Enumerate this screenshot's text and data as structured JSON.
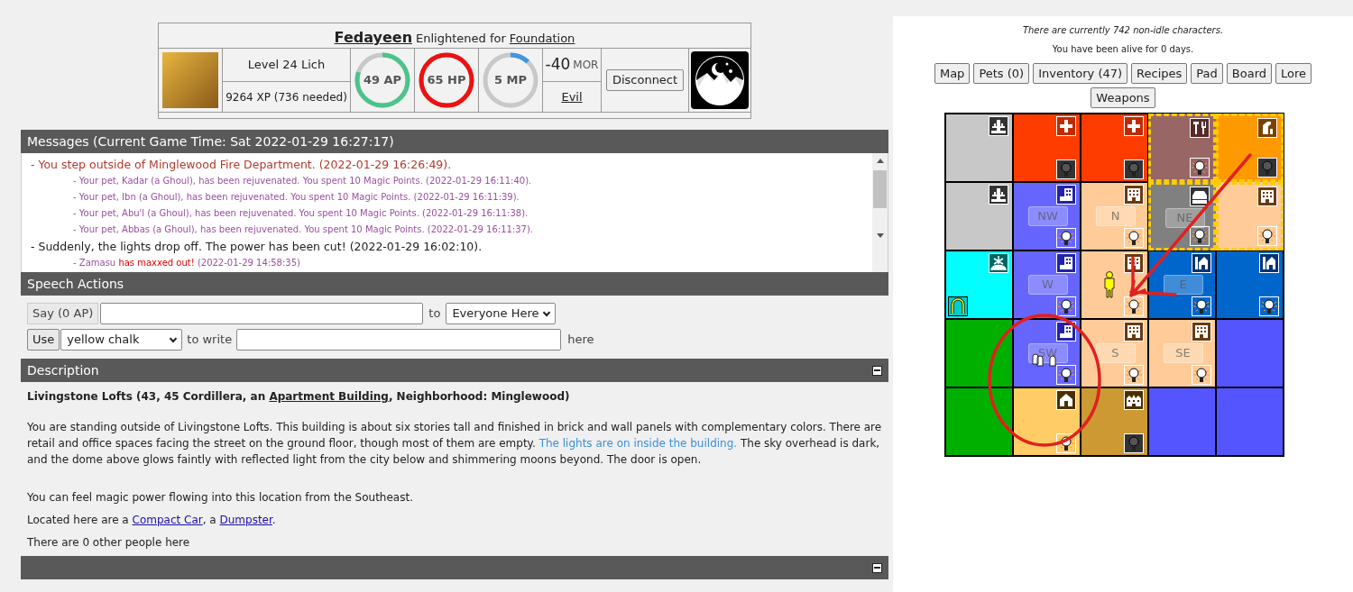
{
  "character": {
    "name": "Fedayeen",
    "title": "Enlightened for",
    "faction": "Foundation",
    "level": "Level 24 Lich",
    "xp": "9264 XP (736 needed)",
    "stats": [
      {
        "label": "49 AP",
        "level": 0.8,
        "color": "#4cc38a"
      },
      {
        "label": "65 HP",
        "level": 1,
        "color": "#ee1111"
      },
      {
        "label": "5 MP",
        "level": 0.12,
        "color": "#3f97e0"
      }
    ],
    "morality": "-40",
    "morality_unit": "MOR",
    "alignment": "Evil",
    "disconnect": "Disconnect"
  },
  "messages": {
    "title": "Messages (Current Game Time: Sat 2022-01-29 16:27:17)",
    "items": [
      {
        "kind": "action",
        "text": "- You step outside of Minglewood Fire Department. (2022-01-29 16:26:49)."
      },
      {
        "kind": "pet",
        "text": "- Your pet, Kadar (a Ghoul), has been rejuvenated. You spent 10 Magic Points. (2022-01-29 16:11:40)."
      },
      {
        "kind": "pet",
        "text": "- Your pet, Ibn (a Ghoul), has been rejuvenated. You spent 10 Magic Points. (2022-01-29 16:11:39)."
      },
      {
        "kind": "pet",
        "text": "- Your pet, Abu'l (a Ghoul), has been rejuvenated. You spent 10 Magic Points. (2022-01-29 16:11:38)."
      },
      {
        "kind": "pet",
        "text": "- Your pet, Abbas (a Ghoul), has been rejuvenated. You spent 10 Magic Points. (2022-01-29 16:11:37)."
      },
      {
        "kind": "event",
        "text": "- Suddenly, the lights drop off. The power has been cut! (2022-01-29 16:02:10)."
      },
      {
        "kind": "pet",
        "text": "- Zamasu ",
        "alert": "has maxxed out!",
        "tail": " (2022-01-29 14:58:35)"
      }
    ]
  },
  "speech_actions": {
    "title": "Speech Actions",
    "say_button": "Say (0 AP)",
    "to": "to",
    "target": "Everyone Here",
    "use_button": "Use",
    "item": "yellow chalk",
    "to_write": "to write",
    "here": "here"
  },
  "description": {
    "title": "Description",
    "heading": [
      {
        "text": "Livingstone Lofts (43, 45 Cordillera, an ",
        "link": false
      },
      {
        "text": "Apartment Building",
        "link": true
      },
      {
        "text": ", Neighborhood: Minglewood)",
        "link": false
      }
    ],
    "paragraph": [
      {
        "text": "You are standing outside of Livingstone Lofts. This building is about six stories tall and finished in brick and wall panels with complementary colors. There are retail and office spaces facing the street on the ground floor, though most of them are empty. ",
        "lit": false
      },
      {
        "text": "The lights are on inside the building.",
        "lit": true
      },
      {
        "text": " The sky overhead is dark, and the dome above glows faintly with reflected light from the city below and shimmering moons beyond. The door is open.",
        "lit": false
      }
    ],
    "magic": "You can feel magic power flowing into this location from the Southeast.",
    "located": [
      {
        "text": "Located here are a ",
        "link": false
      },
      {
        "text": "Compact Car",
        "link": true
      },
      {
        "text": ", a ",
        "link": false
      },
      {
        "text": "Dumpster",
        "link": true
      },
      {
        "text": ".",
        "link": false
      }
    ],
    "people": "There are 0 other people here"
  },
  "status": [
    "There are currently 742 non-idle characters.",
    "You have been alive for 0 days."
  ],
  "nav_buttons": [
    "Map",
    "Pets (0)",
    "Inventory (47)",
    "Recipes",
    "Pad",
    "Board",
    "Lore",
    "Weapons"
  ],
  "map": {
    "cells": [
      {
        "color": "#c8c8c8",
        "kind": "landmark",
        "highlighted": false
      },
      {
        "color": "#ff3c00",
        "kind": "hospital",
        "lit": false,
        "highlighted": false
      },
      {
        "color": "#ff3c00",
        "kind": "hospital",
        "lit": false,
        "highlighted": false
      },
      {
        "color": "#996666",
        "kind": "tools",
        "lit": true,
        "highlighted": true
      },
      {
        "color": "#ff9900",
        "kind": "shop",
        "lit": false,
        "highlighted": true
      },
      {
        "color": "#c8c8c8",
        "kind": "landmark",
        "highlighted": false
      },
      {
        "color": "#6666ff",
        "kind": "tower",
        "label": "NW",
        "lit": true,
        "highlighted": false
      },
      {
        "color": "#ffcc99",
        "kind": "office",
        "label": "N",
        "lit": true,
        "highlighted": false
      },
      {
        "color": "#808080",
        "kind": "car",
        "label": "NE",
        "lit": true,
        "highlighted": true
      },
      {
        "color": "#ffcc99",
        "kind": "office",
        "lit": true,
        "highlighted": true
      },
      {
        "color": "#00ffff",
        "kind": "fountain",
        "portal": true,
        "highlighted": false
      },
      {
        "color": "#6666ff",
        "kind": "tower",
        "label": "W",
        "lit": true,
        "highlighted": false
      },
      {
        "color": "#ffcc99",
        "kind": "office",
        "lit": true,
        "player": true,
        "highlighted": false
      },
      {
        "color": "#0066cc",
        "kind": "station",
        "label": "E",
        "lit": true,
        "highlighted": false
      },
      {
        "color": "#0066cc",
        "kind": "station",
        "lit": true,
        "highlighted": false
      },
      {
        "color": "#00b000",
        "highlighted": false
      },
      {
        "color": "#6666ff",
        "kind": "tower",
        "label": "SW",
        "lit": true,
        "pets": true,
        "highlighted": false
      },
      {
        "color": "#ffcc99",
        "kind": "office",
        "label": "S",
        "lit": true,
        "highlighted": false
      },
      {
        "color": "#ffcc99",
        "kind": "office",
        "label": "SE",
        "lit": true,
        "highlighted": false
      },
      {
        "color": "#5555ff",
        "highlighted": false
      },
      {
        "color": "#00b000",
        "highlighted": false
      },
      {
        "color": "#ffcc66",
        "kind": "house",
        "lit": true,
        "highlighted": false
      },
      {
        "color": "#cc9933",
        "kind": "mansion",
        "lit": false,
        "highlighted": false
      },
      {
        "color": "#5555ff",
        "highlighted": false
      },
      {
        "color": "#5555ff",
        "highlighted": false
      }
    ]
  }
}
